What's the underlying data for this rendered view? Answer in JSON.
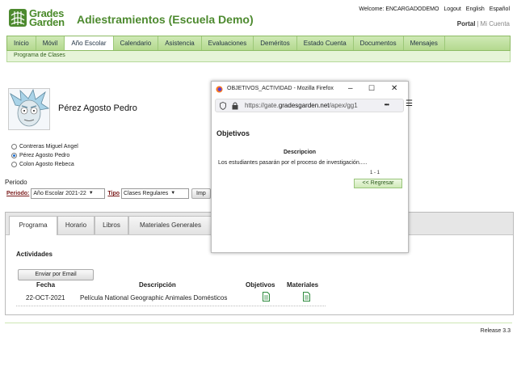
{
  "header": {
    "logo_line1": "Grades",
    "logo_line2": "Garden",
    "app_title": "Adiestramientos (Escuela Demo)",
    "welcome": "Welcome: ENCARGADODEMO",
    "logout": "Logout",
    "english": "English",
    "espanol": "Español",
    "portal": "Portal",
    "separator": "|",
    "mi_cuenta": "Mi Cuenta"
  },
  "nav": {
    "tabs": [
      "Inicio",
      "Móvil",
      "Año Escolar",
      "Calendario",
      "Asistencia",
      "Evaluaciones",
      "Deméritos",
      "Estado Cuenta",
      "Documentos",
      "Mensajes"
    ],
    "active": "Año Escolar",
    "sub_item": "Programa de Clases"
  },
  "student": {
    "name": "Pérez Agosto Pedro",
    "options": [
      "Contreras Miguel Angel",
      "Pérez Agosto Pedro",
      "Colon Agosto Rebeca"
    ],
    "selected": "Pérez Agosto Pedro"
  },
  "periodo": {
    "heading": "Periodo",
    "periodo_label": "Periodo:",
    "periodo_value": "Año Escolar 2021-22",
    "tipo_label": "Tipo",
    "tipo_value": "Clases Regulares",
    "button_label": "Imp"
  },
  "subtabs": [
    "Programa",
    "Horario",
    "Libros",
    "Materiales Generales"
  ],
  "activities": {
    "title": "Actividades",
    "email_button": "Enviar por Email",
    "headers": {
      "fecha": "Fecha",
      "descripcion": "Descripción",
      "objetivos": "Objetivos",
      "materiales": "Materiales"
    },
    "rows": [
      {
        "fecha": "22-OCT-2021",
        "descripcion": "Película National Geographic Animales Domésticos"
      }
    ]
  },
  "footer": {
    "release": "Release 3.3"
  },
  "popup": {
    "title": "OBJETIVOS_ACTIVIDAD - Mozilla Firefox",
    "url_prefix": "https://gate.",
    "url_domain": "gradesgarden.net",
    "url_suffix": "/apex/gg1",
    "dots": "•••",
    "heading": "Objetivos",
    "column": "Descripcion",
    "text": "Los estudiantes pasarán por el proceso de investigación.....",
    "pagination": "1 - 1",
    "back_button": "<< Regresar"
  },
  "colors": {
    "brand_green": "#4d8a2f",
    "nav_green": "#b4d98f",
    "label_red": "#7a1a1a"
  }
}
